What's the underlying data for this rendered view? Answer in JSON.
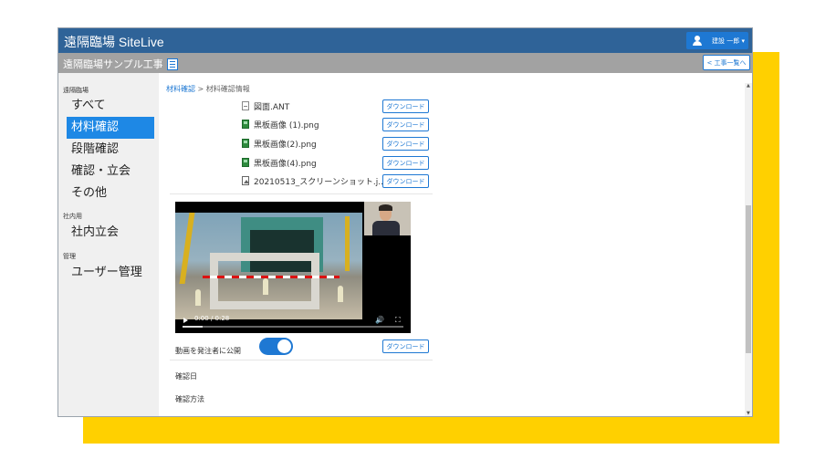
{
  "header": {
    "app_title": "遠隔臨場 SiteLive",
    "user_name": "建設 一郎 ▾",
    "user_icon": "user-icon"
  },
  "subheader": {
    "project_name": "遠隔臨場サンプル工事",
    "project_icon": "document-list-icon",
    "back_label": "< 工事一覧へ"
  },
  "sidebar": {
    "group1_label": "遠隔臨場",
    "items": [
      {
        "label": "すべて",
        "active": false
      },
      {
        "label": "材料確認",
        "active": true
      },
      {
        "label": "段階確認",
        "active": false
      },
      {
        "label": "確認・立会",
        "active": false
      },
      {
        "label": "その他",
        "active": false
      }
    ],
    "group2_label": "社内用",
    "items2": [
      {
        "label": "社内立会"
      }
    ],
    "group3_label": "管理",
    "items3": [
      {
        "label": "ユーザー管理"
      }
    ]
  },
  "breadcrumb": {
    "link": "材料確認",
    "separator": ">",
    "current": "材料確認情報"
  },
  "files": [
    {
      "name": "図面.ANT",
      "icon": "document-icon",
      "download_label": "ダウンロード"
    },
    {
      "name": "黒板画像 (1).png",
      "icon": "image-file-icon",
      "download_label": "ダウンロード"
    },
    {
      "name": "黒板画像(2).png",
      "icon": "image-file-icon",
      "download_label": "ダウンロード"
    },
    {
      "name": "黒板画像(4).png",
      "icon": "image-file-icon",
      "download_label": "ダウンロード"
    },
    {
      "name": "20210513_スクリーンショット.j...",
      "icon": "picture-icon",
      "download_label": "ダウンロード"
    }
  ],
  "video": {
    "time": "0:00 / 0:28",
    "progress": 0.09,
    "volume_icon": "volume-icon",
    "fullscreen_icon": "fullscreen-icon",
    "play_icon": "play-icon"
  },
  "publish": {
    "label": "動画を発注者に公開",
    "enabled": true,
    "download_label": "ダウンロード"
  },
  "fields": {
    "confirm_date_label": "確認日",
    "confirm_method_label": "確認方法"
  },
  "colors": {
    "topbar": "#2f6398",
    "accent": "#1e78d3",
    "active_nav": "#1e88e5",
    "subbar": "#a2a2a2",
    "backdrop": "#ffd000"
  }
}
